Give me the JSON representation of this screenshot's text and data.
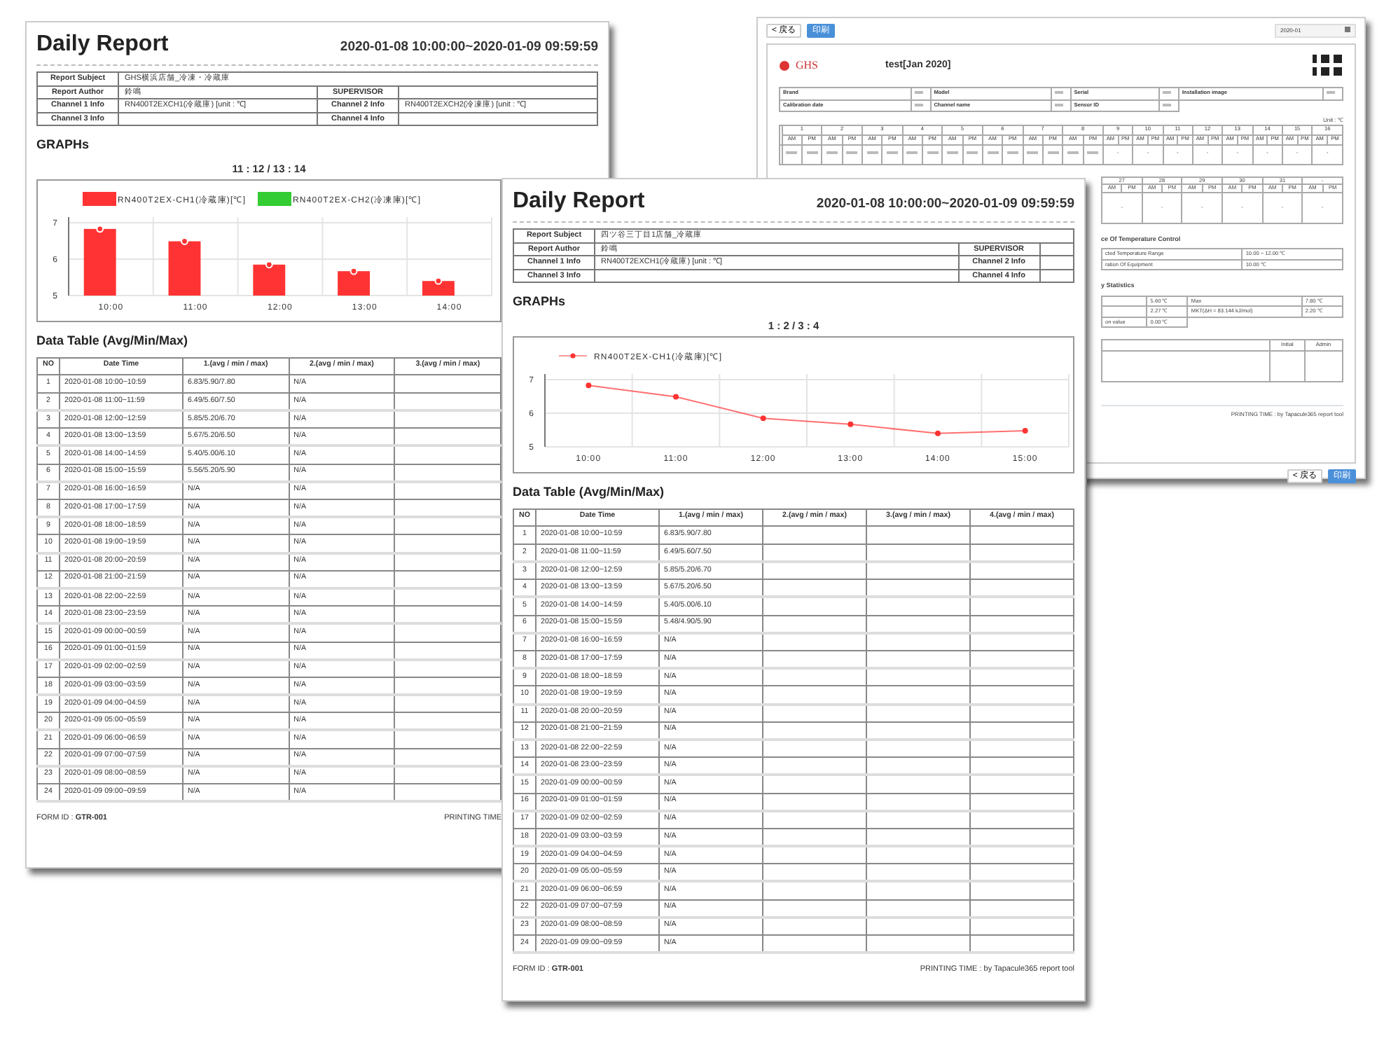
{
  "left_report": {
    "title": "Daily Report",
    "period": "2020-01-08 10:00:00~2020-01-09 09:59:59",
    "info": [
      [
        {
          "label": "Report Subject",
          "value": "GHS横浜店舗_冷凍・冷蔵庫"
        }
      ],
      [
        {
          "label": "Report Author",
          "value": "鈴鳴"
        },
        {
          "label": "SUPERVISOR"
        }
      ],
      [
        {
          "label": "Channel 1 Info",
          "value": "RN400T2EXCH1(冷蔵庫) [unit : ℃]"
        },
        {
          "label": "Channel 2 Info",
          "value": "RN400T2EXCH2(冷凍庫) [unit : ℃]"
        }
      ],
      [
        {
          "label": "Channel 3 Info"
        },
        {
          "label": "Channel 4 Info"
        }
      ]
    ],
    "graphs_heading": "GRAPHs",
    "graph": {
      "title": "11 : 12 / 13 : 14",
      "chart_data": {
        "type": "bar",
        "categories": [
          "10:00",
          "11:00",
          "12:00",
          "13:00",
          "14:00"
        ],
        "series": [
          {
            "name": "RN400T2EX-CH1(冷蔵庫)[℃]",
            "color": "#ff3333",
            "values": [
              6.83,
              6.49,
              5.85,
              5.67,
              5.4
            ]
          },
          {
            "name": "RN400T2EX-CH2(冷凍庫)[℃]",
            "color": "#33cc33",
            "values": [
              null,
              null,
              null,
              null,
              null
            ]
          }
        ],
        "ylim": [
          5,
          7
        ],
        "yticks": [
          5,
          6,
          7
        ]
      }
    },
    "table_heading": "Data Table (Avg/Min/Max)",
    "table": {
      "columns": [
        "NO",
        "Date Time",
        "1.(avg / min / max)",
        "2.(avg / min / max)",
        "3.(avg / min / max)"
      ],
      "rows": [
        {
          "no": "1",
          "date_time": "2020-01-08 10:00~10:59",
          "values": [
            "6.83/5.90/7.80",
            "N/A"
          ]
        },
        {
          "no": "2",
          "date_time": "2020-01-08 11:00~11:59",
          "values": [
            "6.49/5.60/7.50",
            "N/A"
          ]
        },
        {
          "no": "3",
          "date_time": "2020-01-08 12:00~12:59",
          "values": [
            "5.85/5.20/6.70",
            "N/A"
          ]
        },
        {
          "no": "4",
          "date_time": "2020-01-08 13:00~13:59",
          "values": [
            "5.67/5.20/6.50",
            "N/A"
          ]
        },
        {
          "no": "5",
          "date_time": "2020-01-08 14:00~14:59",
          "values": [
            "5.40/5.00/6.10",
            "N/A"
          ]
        },
        {
          "no": "6",
          "date_time": "2020-01-08 15:00~15:59",
          "values": [
            "5.56/5.20/5.90",
            "N/A"
          ]
        },
        {
          "no": "7",
          "date_time": "2020-01-08 16:00~16:59",
          "values": [
            "N/A",
            "N/A"
          ]
        },
        {
          "no": "8",
          "date_time": "2020-01-08 17:00~17:59",
          "values": [
            "N/A",
            "N/A"
          ]
        },
        {
          "no": "9",
          "date_time": "2020-01-08 18:00~18:59",
          "values": [
            "N/A",
            "N/A"
          ]
        },
        {
          "no": "10",
          "date_time": "2020-01-08 19:00~19:59",
          "values": [
            "N/A",
            "N/A"
          ]
        },
        {
          "no": "11",
          "date_time": "2020-01-08 20:00~20:59",
          "values": [
            "N/A",
            "N/A"
          ]
        },
        {
          "no": "12",
          "date_time": "2020-01-08 21:00~21:59",
          "values": [
            "N/A",
            "N/A"
          ]
        },
        {
          "no": "13",
          "date_time": "2020-01-08 22:00~22:59",
          "values": [
            "N/A",
            "N/A"
          ]
        },
        {
          "no": "14",
          "date_time": "2020-01-08 23:00~23:59",
          "values": [
            "N/A",
            "N/A"
          ]
        },
        {
          "no": "15",
          "date_time": "2020-01-09 00:00~00:59",
          "values": [
            "N/A",
            "N/A"
          ]
        },
        {
          "no": "16",
          "date_time": "2020-01-09 01:00~01:59",
          "values": [
            "N/A",
            "N/A"
          ]
        },
        {
          "no": "17",
          "date_time": "2020-01-09 02:00~02:59",
          "values": [
            "N/A",
            "N/A"
          ]
        },
        {
          "no": "18",
          "date_time": "2020-01-09 03:00~03:59",
          "values": [
            "N/A",
            "N/A"
          ]
        },
        {
          "no": "19",
          "date_time": "2020-01-09 04:00~04:59",
          "values": [
            "N/A",
            "N/A"
          ]
        },
        {
          "no": "20",
          "date_time": "2020-01-09 05:00~05:59",
          "values": [
            "N/A",
            "N/A"
          ]
        },
        {
          "no": "21",
          "date_time": "2020-01-09 06:00~06:59",
          "values": [
            "N/A",
            "N/A"
          ]
        },
        {
          "no": "22",
          "date_time": "2020-01-09 07:00~07:59",
          "values": [
            "N/A",
            "N/A"
          ]
        },
        {
          "no": "23",
          "date_time": "2020-01-09 08:00~08:59",
          "values": [
            "N/A",
            "N/A"
          ]
        },
        {
          "no": "24",
          "date_time": "2020-01-09 09:00~09:59",
          "values": [
            "N/A",
            "N/A"
          ]
        }
      ]
    },
    "footer": {
      "form_id": "FORM ID : **GTR-001**",
      "printing_time": "PRINTING TIME"
    }
  },
  "front_report": {
    "title": "Daily Report",
    "period": "2020-01-08 10:00:00~2020-01-09 09:59:59",
    "info": [
      [
        {
          "label": "Report Subject",
          "value": "四ツ谷三丁目1店舗_冷蔵庫"
        }
      ],
      [
        {
          "label": "Report Author",
          "value": "鈴鳴"
        },
        {
          "label": "SUPERVISOR"
        }
      ],
      [
        {
          "label": "Channel 1 Info",
          "value": "RN400T2EXCH1(冷蔵庫) [unit : ℃]"
        },
        {
          "label": "Channel 2 Info"
        }
      ],
      [
        {
          "label": "Channel 3 Info"
        },
        {
          "label": "Channel 4 Info"
        }
      ]
    ],
    "graphs_heading": "GRAPHs",
    "graph": {
      "title": "1 : 2 / 3 : 4",
      "chart_data": {
        "type": "line",
        "categories": [
          "10:00",
          "11:00",
          "12:00",
          "13:00",
          "14:00",
          "15:00"
        ],
        "series": [
          {
            "name": "RN400T2EX-CH1(冷蔵庫)[℃]",
            "color": "#ff3333",
            "marker": true,
            "values": [
              6.83,
              6.49,
              5.85,
              5.67,
              5.4,
              5.48
            ]
          }
        ],
        "ylim": [
          5,
          7
        ],
        "yticks": [
          5,
          6,
          7
        ]
      }
    },
    "table_heading": "Data Table (Avg/Min/Max)",
    "table": {
      "columns": [
        "NO",
        "Date Time",
        "1.(avg / min / max)",
        "2.(avg / min / max)",
        "3.(avg / min / max)",
        "4.(avg / min / max)"
      ],
      "rows": [
        {
          "no": "1",
          "date_time": "2020-01-08 10:00~10:59",
          "values": [
            "6.83/5.90/7.80"
          ]
        },
        {
          "no": "2",
          "date_time": "2020-01-08 11:00~11:59",
          "values": [
            "6.49/5.60/7.50"
          ]
        },
        {
          "no": "3",
          "date_time": "2020-01-08 12:00~12:59",
          "values": [
            "5.85/5.20/6.70"
          ]
        },
        {
          "no": "4",
          "date_time": "2020-01-08 13:00~13:59",
          "values": [
            "5.67/5.20/6.50"
          ]
        },
        {
          "no": "5",
          "date_time": "2020-01-08 14:00~14:59",
          "values": [
            "5.40/5.00/6.10"
          ]
        },
        {
          "no": "6",
          "date_time": "2020-01-08 15:00~15:59",
          "values": [
            "5.48/4.90/5.90"
          ]
        },
        {
          "no": "7",
          "date_time": "2020-01-08 16:00~16:59",
          "values": [
            "N/A"
          ]
        },
        {
          "no": "8",
          "date_time": "2020-01-08 17:00~17:59",
          "values": [
            "N/A"
          ]
        },
        {
          "no": "9",
          "date_time": "2020-01-08 18:00~18:59",
          "values": [
            "N/A"
          ]
        },
        {
          "no": "10",
          "date_time": "2020-01-08 19:00~19:59",
          "values": [
            "N/A"
          ]
        },
        {
          "no": "11",
          "date_time": "2020-01-08 20:00~20:59",
          "values": [
            "N/A"
          ]
        },
        {
          "no": "12",
          "date_time": "2020-01-08 21:00~21:59",
          "values": [
            "N/A"
          ]
        },
        {
          "no": "13",
          "date_time": "2020-01-08 22:00~22:59",
          "values": [
            "N/A"
          ]
        },
        {
          "no": "14",
          "date_time": "2020-01-08 23:00~23:59",
          "values": [
            "N/A"
          ]
        },
        {
          "no": "15",
          "date_time": "2020-01-09 00:00~00:59",
          "values": [
            "N/A"
          ]
        },
        {
          "no": "16",
          "date_time": "2020-01-09 01:00~01:59",
          "values": [
            "N/A"
          ]
        },
        {
          "no": "17",
          "date_time": "2020-01-09 02:00~02:59",
          "values": [
            "N/A"
          ]
        },
        {
          "no": "18",
          "date_time": "2020-01-09 03:00~03:59",
          "values": [
            "N/A"
          ]
        },
        {
          "no": "19",
          "date_time": "2020-01-09 04:00~04:59",
          "values": [
            "N/A"
          ]
        },
        {
          "no": "20",
          "date_time": "2020-01-09 05:00~05:59",
          "values": [
            "N/A"
          ]
        },
        {
          "no": "21",
          "date_time": "2020-01-09 06:00~06:59",
          "values": [
            "N/A"
          ]
        },
        {
          "no": "22",
          "date_time": "2020-01-09 07:00~07:59",
          "values": [
            "N/A"
          ]
        },
        {
          "no": "23",
          "date_time": "2020-01-09 08:00~08:59",
          "values": [
            "N/A"
          ]
        },
        {
          "no": "24",
          "date_time": "2020-01-09 09:00~09:59",
          "values": [
            "N/A"
          ]
        }
      ]
    },
    "footer": {
      "form_id": "FORM ID : **GTR-001**",
      "printing_time": "PRINTING TIME : by Tapacule365 report tool"
    }
  },
  "monthly_report": {
    "back_button": "< 戻る",
    "print_button": "印刷",
    "month_field": "2020-01",
    "logo": "GHS",
    "title": "test[Jan 2020]",
    "info_labels": [
      [
        "Brand",
        "Model",
        "Serial",
        "Installation image"
      ],
      [
        "Calibration date",
        "Channel name",
        "Sensor ID"
      ]
    ],
    "unit": "Unit : ℃",
    "calendar_days": [
      {
        "day": "1",
        "am": "AM",
        "pm": "PM",
        "kind": "filled"
      },
      {
        "day": "2",
        "am": "AM",
        "pm": "PM",
        "kind": "filled"
      },
      {
        "day": "3",
        "am": "AM",
        "pm": "PM",
        "kind": "filled"
      },
      {
        "day": "4",
        "am": "AM",
        "pm": "PM",
        "kind": "filled"
      },
      {
        "day": "5",
        "am": "AM",
        "pm": "PM",
        "kind": "filled"
      },
      {
        "day": "6",
        "am": "AM",
        "pm": "PM",
        "kind": "filled"
      },
      {
        "day": "7",
        "am": "AM",
        "pm": "PM",
        "kind": "filled"
      },
      {
        "day": "8",
        "am": "AM",
        "pm": "PM",
        "kind": "filled"
      },
      {
        "day": "9",
        "am": "AM",
        "pm": "PM",
        "kind": "empty",
        "mark": "-"
      },
      {
        "day": "10",
        "am": "AM",
        "pm": "PM",
        "kind": "empty",
        "mark": "-"
      },
      {
        "day": "11",
        "am": "AM",
        "pm": "PM",
        "kind": "empty",
        "mark": "-"
      },
      {
        "day": "12",
        "am": "AM",
        "pm": "PM",
        "kind": "empty",
        "mark": "-"
      },
      {
        "day": "13",
        "am": "AM",
        "pm": "PM",
        "kind": "empty",
        "mark": "-"
      },
      {
        "day": "14",
        "am": "AM",
        "pm": "PM",
        "kind": "empty",
        "mark": "-"
      },
      {
        "day": "15",
        "am": "AM",
        "pm": "PM",
        "kind": "empty",
        "mark": "-"
      },
      {
        "day": "16",
        "am": "AM",
        "pm": "PM",
        "kind": "empty",
        "mark": "-"
      }
    ],
    "calendar_days_2": [
      {
        "day": "27",
        "am": "AM",
        "pm": "PM",
        "kind": "empty",
        "mark": "-"
      },
      {
        "day": "28",
        "am": "AM",
        "pm": "PM",
        "kind": "empty",
        "mark": "-"
      },
      {
        "day": "29",
        "am": "AM",
        "pm": "PM",
        "kind": "empty",
        "mark": "-"
      },
      {
        "day": "30",
        "am": "AM",
        "pm": "PM",
        "kind": "empty",
        "mark": "-"
      },
      {
        "day": "31",
        "am": "AM",
        "pm": "PM",
        "kind": "empty",
        "mark": "-"
      },
      {
        "day": "-",
        "am": "AM",
        "pm": "PM",
        "kind": "empty",
        "mark": "-"
      }
    ],
    "control_heading": "ce Of Temperature Control",
    "control_rows": [
      [
        "cted Temperature Range",
        "10.00 ~ 12.00 ℃"
      ],
      [
        "ration Of Equipment",
        "10.00 ℃"
      ]
    ],
    "stats_heading": "y Statistics",
    "stats_rows": [
      [
        "",
        "5.60 ℃",
        "Max",
        "7.80 ℃"
      ],
      [
        "",
        "2.27 ℃",
        "MKT(ΔH = 83.144 kJ/mol)",
        "2.20 ℃"
      ],
      [
        "on value",
        "0.00 ℃"
      ]
    ],
    "remarks_columns": [
      "Initial",
      "Admin"
    ],
    "printing_time": "PRINTING TIME : by Tapacule365 report tool",
    "bottom_back_button": "< 戻る",
    "bottom_print_button": "印刷"
  }
}
